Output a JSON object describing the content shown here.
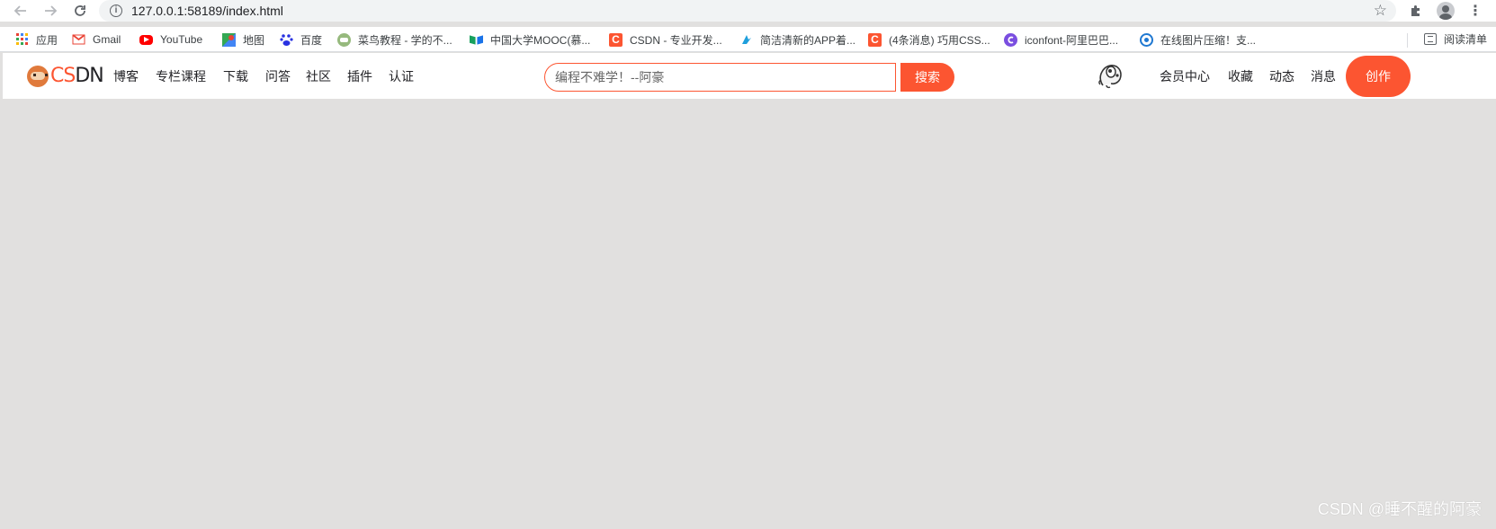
{
  "browser": {
    "url": "127.0.0.1:58189/index.html"
  },
  "bookmarks": [
    {
      "label": "应用",
      "icon": "apps-grid-icon"
    },
    {
      "label": "Gmail",
      "icon": "gmail-icon"
    },
    {
      "label": "YouTube",
      "icon": "youtube-icon"
    },
    {
      "label": "地图",
      "icon": "maps-icon"
    },
    {
      "label": "百度",
      "icon": "baidu-icon"
    },
    {
      "label": "菜鸟教程 - 学的不...",
      "icon": "runoob-icon"
    },
    {
      "label": "中国大学MOOC(慕...",
      "icon": "mooc-icon"
    },
    {
      "label": "CSDN - 专业开发...",
      "icon": "csdn-icon"
    },
    {
      "label": "简洁清新的APP着...",
      "icon": "app-icon"
    },
    {
      "label": "(4条消息) 巧用CSS...",
      "icon": "csdn-icon"
    },
    {
      "label": "iconfont-阿里巴巴...",
      "icon": "iconfont-icon"
    },
    {
      "label": "在线图片压缩！支...",
      "icon": "compress-icon"
    }
  ],
  "reading_list": "阅读清单",
  "site": {
    "logo_text_c": "CS",
    "logo_text_dn": "DN",
    "nav": [
      "博客",
      "专栏课程",
      "下载",
      "问答",
      "社区",
      "插件",
      "认证"
    ],
    "search_placeholder": "编程不难学！--阿豪",
    "search_button": "搜索",
    "right_nav": [
      "会员中心",
      "收藏",
      "动态",
      "消息"
    ],
    "create_button": "创作"
  },
  "watermark": "CSDN @睡不醒的阿豪",
  "colors": {
    "accent": "#fc5531",
    "page_background": "#e1e0df"
  }
}
